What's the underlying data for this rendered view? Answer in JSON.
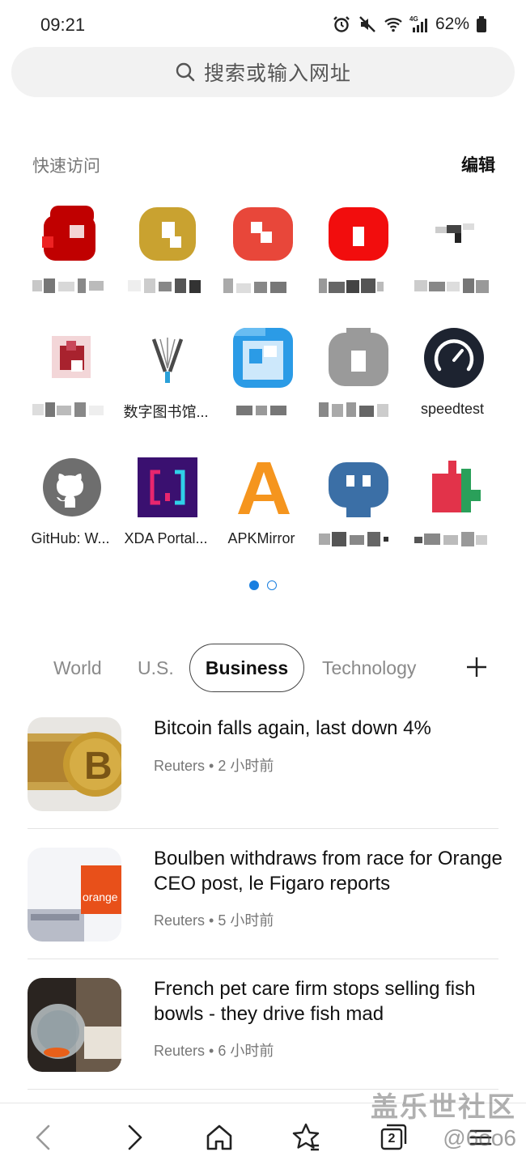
{
  "status_bar": {
    "time": "09:21",
    "battery": "62%"
  },
  "search": {
    "placeholder": "搜索或输入网址"
  },
  "quick_access": {
    "title": "快速访问",
    "edit_label": "编辑",
    "rows": [
      [
        {
          "label": "",
          "color": "#c00000"
        },
        {
          "label": "",
          "color": "#c9a230"
        },
        {
          "label": "",
          "color": "#e8473a"
        },
        {
          "label": "",
          "color": "#f20d0d"
        },
        {
          "label": "",
          "color": "#444444"
        }
      ],
      [
        {
          "label": "",
          "color": "#a8222e"
        },
        {
          "label": "数字图书馆...",
          "color": "#4a4a4a"
        },
        {
          "label": "",
          "color": "#2b9be6"
        },
        {
          "label": "",
          "color": "#9a9a9a"
        },
        {
          "label": "speedtest",
          "color": "#1d2330"
        }
      ],
      [
        {
          "label": "GitHub: W...",
          "color": "#6e6e6e"
        },
        {
          "label": "XDA Portal...",
          "color": "#3a1070"
        },
        {
          "label": "APKMirror",
          "color": "#f5951e"
        },
        {
          "label": "",
          "color": "#3b6fa6"
        },
        {
          "label": "",
          "color": "#e2334a"
        }
      ]
    ]
  },
  "news_tabs": {
    "tabs": [
      "World",
      "U.S.",
      "Business",
      "Technology"
    ],
    "selected": "Business"
  },
  "news": [
    {
      "title": "Bitcoin falls again, last down 4%",
      "source": "Reuters",
      "time": "2 小时前"
    },
    {
      "title": "Boulben withdraws from race for Orange CEO post, le Figaro reports",
      "source": "Reuters",
      "time": "5 小时前"
    },
    {
      "title": "French pet care firm stops selling fish bowls - they drive fish mad",
      "source": "Reuters",
      "time": "6 小时前"
    }
  ],
  "bottom_nav": {
    "tab_count": "2"
  },
  "watermark": {
    "line1": "盖乐世社区",
    "line2": "@6oo6"
  }
}
